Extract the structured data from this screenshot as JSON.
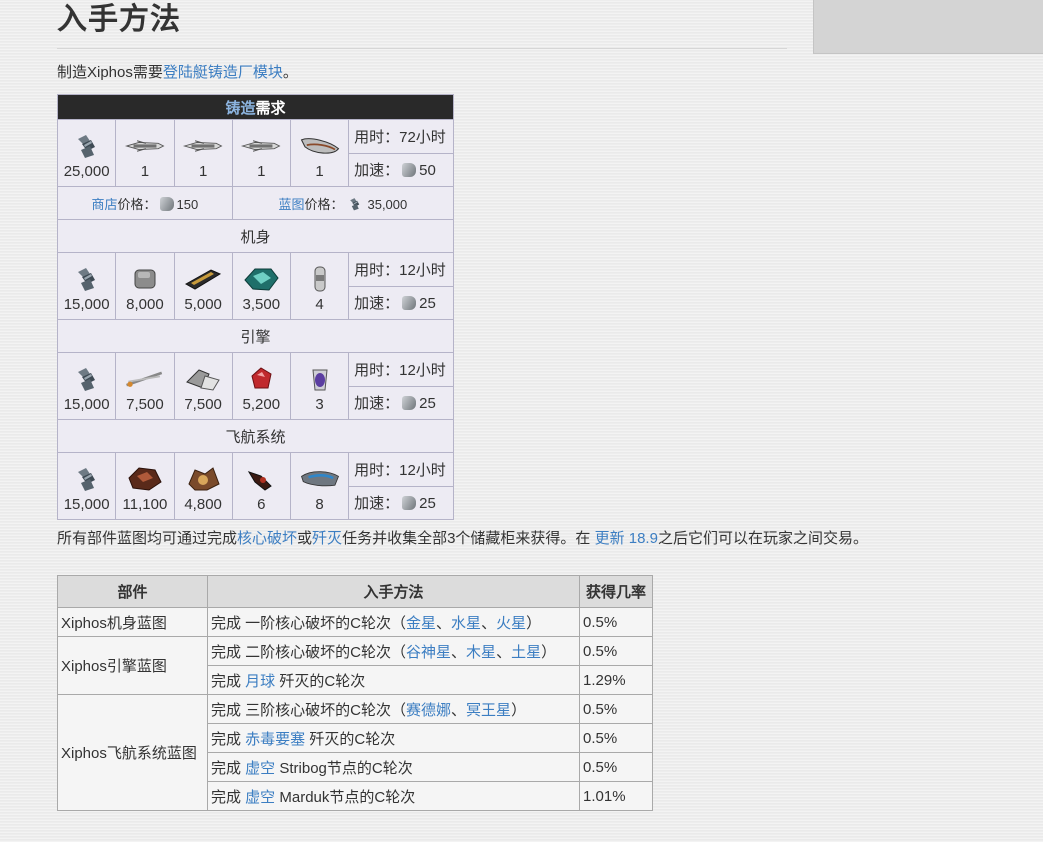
{
  "heading": "入手方法",
  "intro": {
    "prefix": "制造Xiphos需要",
    "link": "登陆艇铸造厂模块",
    "suffix": "。"
  },
  "foundry": {
    "header_link": "铸造",
    "header_text": "需求",
    "main": {
      "items": [
        {
          "icon": "credits-icon",
          "value": "25,000"
        },
        {
          "icon": "engine-blueprint-icon",
          "value": "1"
        },
        {
          "icon": "avionics-blueprint-icon",
          "value": "1"
        },
        {
          "icon": "fuselage-blueprint-icon",
          "value": "1"
        },
        {
          "icon": "xiphos-icon",
          "value": "1"
        }
      ],
      "time_label": "用时：",
      "time_value": "72小时",
      "rush_label": "加速：",
      "rush_value": "50"
    },
    "market_link": "商店",
    "market_label": "价格：",
    "market_value": "150",
    "blueprint_link": "蓝图",
    "blueprint_label": "价格：",
    "blueprint_value": "35,000",
    "components": [
      {
        "title": "机身",
        "items": [
          {
            "icon": "credits-icon",
            "value": "15,000"
          },
          {
            "icon": "titanium-icon",
            "value": "8,000"
          },
          {
            "icon": "carbides-icon",
            "value": "5,000"
          },
          {
            "icon": "cubic-diodes-icon",
            "value": "3,500"
          },
          {
            "icon": "oxium-icon",
            "value": "4"
          }
        ],
        "time_label": "用时：",
        "time_value": "12小时",
        "rush_label": "加速：",
        "rush_value": "25"
      },
      {
        "title": "引擎",
        "items": [
          {
            "icon": "credits-icon",
            "value": "15,000"
          },
          {
            "icon": "asterite-icon",
            "value": "7,500"
          },
          {
            "icon": "alloy-plate-icon",
            "value": "7,500"
          },
          {
            "icon": "pustrels-icon",
            "value": "5,200"
          },
          {
            "icon": "nitain-extract-icon",
            "value": "3"
          }
        ],
        "time_label": "用时：",
        "time_value": "12小时",
        "rush_label": "加速：",
        "rush_value": "25"
      },
      {
        "title": "飞航系统",
        "items": [
          {
            "icon": "credits-icon",
            "value": "15,000"
          },
          {
            "icon": "copernics-icon",
            "value": "11,100"
          },
          {
            "icon": "nullstones-icon",
            "value": "4,800"
          },
          {
            "icon": "fieldron-icon",
            "value": "6"
          },
          {
            "icon": "detonite-injector-icon",
            "value": "8"
          }
        ],
        "time_label": "用时：",
        "time_value": "12小时",
        "rush_label": "加速：",
        "rush_value": "25"
      }
    ]
  },
  "parts_note": {
    "p1": "所有部件蓝图均可通过完成",
    "link1": "核心破坏",
    "p2": "或",
    "link2": "歼灭",
    "p3": "任务并收集全部3个储藏柜来获得。在 ",
    "link3": "更新 18.9",
    "p4": "之后它们可以在玩家之间交易。"
  },
  "acq_table": {
    "headers": [
      "部件",
      "入手方法",
      "获得几率"
    ],
    "fuselage_label": "Xiphos机身蓝图",
    "engine_label": "Xiphos引擎蓝图",
    "avionics_label": "Xiphos飞航系统蓝图",
    "r1": {
      "a": "完成 一阶核心破坏的C轮次（",
      "l1": "金星",
      "s1": "、",
      "l2": "水星",
      "s2": "、",
      "l3": "火星",
      "b": "）",
      "rate": "0.5%"
    },
    "r2": {
      "a": "完成 二阶核心破坏的C轮次（",
      "l1": "谷神星",
      "s1": "、",
      "l2": "木星",
      "s2": "、",
      "l3": "土星",
      "b": "）",
      "rate": "0.5%"
    },
    "r3": {
      "a": "完成 ",
      "l1": "月球",
      "b": " 歼灭的C轮次",
      "rate": "1.29%"
    },
    "r4": {
      "a": "完成 三阶核心破坏的C轮次（",
      "l1": "赛德娜",
      "s1": "、",
      "l2": "冥王星",
      "b": "）",
      "rate": "0.5%"
    },
    "r5": {
      "a": "完成 ",
      "l1": "赤毒要塞",
      "b": " 歼灭的C轮次",
      "rate": "0.5%"
    },
    "r6": {
      "a": "完成 ",
      "l1": "虚空",
      "b": " Stribog节点的C轮次",
      "rate": "0.5%"
    },
    "r7": {
      "a": "完成 ",
      "l1": "虚空",
      "b": " Marduk节点的C轮次",
      "rate": "1.01%"
    }
  }
}
